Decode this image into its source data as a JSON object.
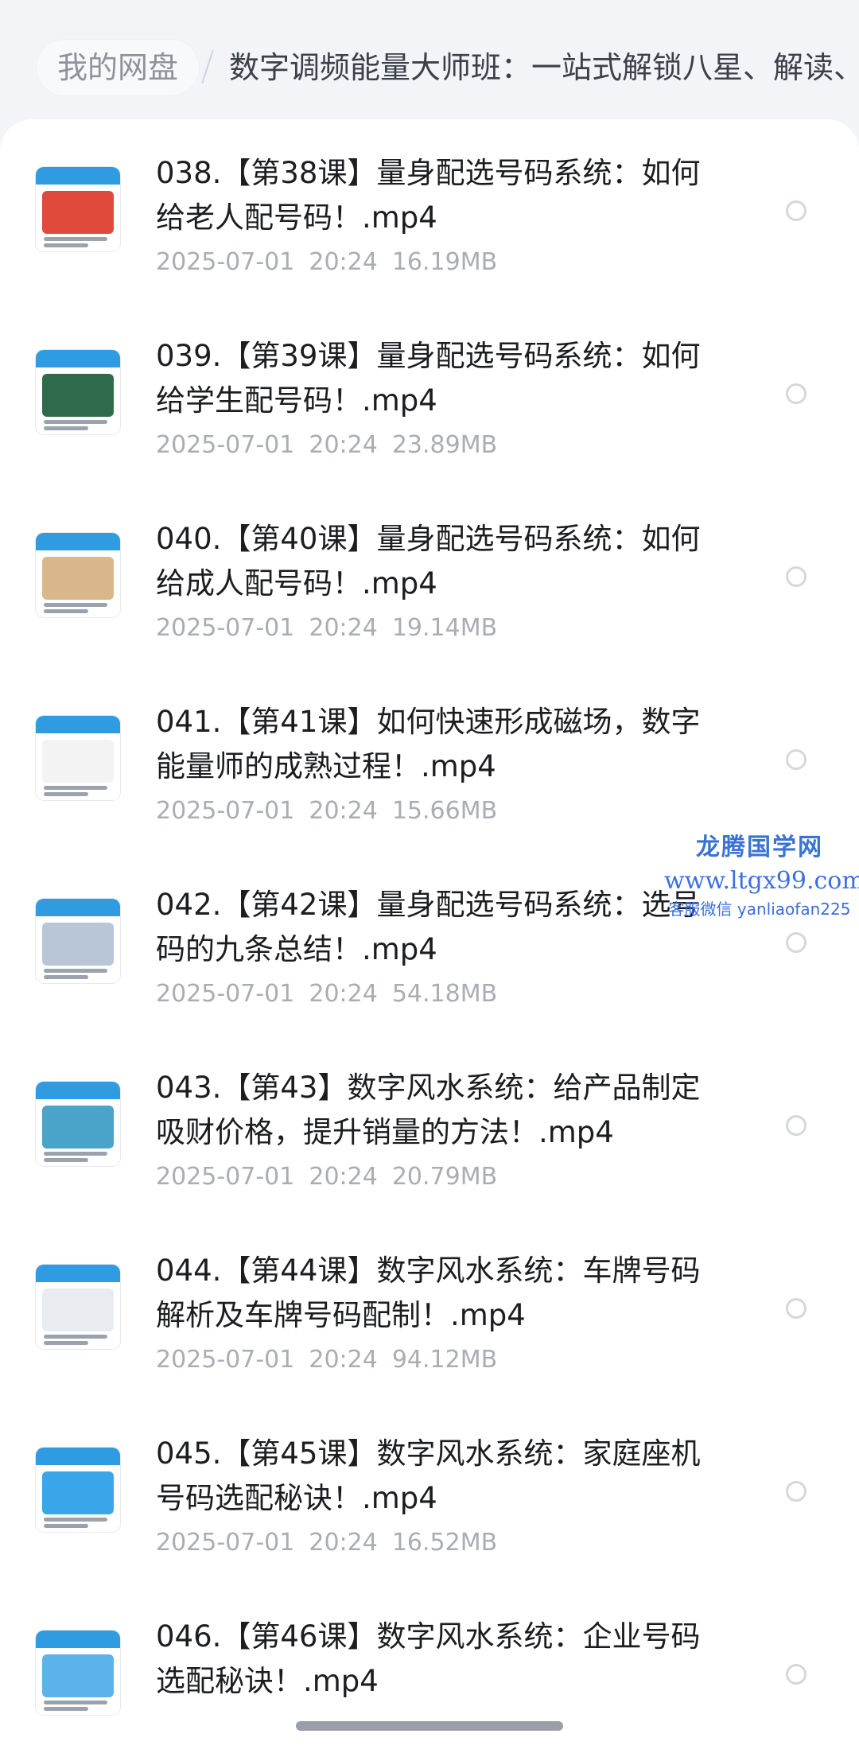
{
  "breadcrumb": {
    "root": "我的网盘",
    "current": "数字调频能量大师班：一站式解锁八星、解读、"
  },
  "files": [
    {
      "title": "038.【第38课】量身配选号码系统：如何给老人配号码！.mp4",
      "date": "2025-07-01",
      "time": "20:24",
      "size": "16.19MB",
      "thumb_color": "#e04a3a"
    },
    {
      "title": "039.【第39课】量身配选号码系统：如何给学生配号码！.mp4",
      "date": "2025-07-01",
      "time": "20:24",
      "size": "23.89MB",
      "thumb_color": "#2f6b4a"
    },
    {
      "title": "040.【第40课】量身配选号码系统：如何给成人配号码！.mp4",
      "date": "2025-07-01",
      "time": "20:24",
      "size": "19.14MB",
      "thumb_color": "#d9b78a"
    },
    {
      "title": "041.【第41课】如何快速形成磁场，数字能量师的成熟过程！.mp4",
      "date": "2025-07-01",
      "time": "20:24",
      "size": "15.66MB",
      "thumb_color": "#f3f3f3"
    },
    {
      "title": "042.【第42课】量身配选号码系统：选号码的九条总结！.mp4",
      "date": "2025-07-01",
      "time": "20:24",
      "size": "54.18MB",
      "thumb_color": "#b8c6d8"
    },
    {
      "title": "043.【第43】数字风水系统：给产品制定吸财价格，提升销量的方法！.mp4",
      "date": "2025-07-01",
      "time": "20:24",
      "size": "20.79MB",
      "thumb_color": "#4aa3c9"
    },
    {
      "title": "044.【第44课】数字风水系统：车牌号码解析及车牌号码配制！.mp4",
      "date": "2025-07-01",
      "time": "20:24",
      "size": "94.12MB",
      "thumb_color": "#e8ecf1"
    },
    {
      "title": "045.【第45课】数字风水系统：家庭座机号码选配秘诀！.mp4",
      "date": "2025-07-01",
      "time": "20:24",
      "size": "16.52MB",
      "thumb_color": "#3aa5e8"
    },
    {
      "title": "046.【第46课】数字风水系统：企业号码选配秘诀！.mp4",
      "date": "",
      "time": "",
      "size": "",
      "thumb_color": "#5bb3ea"
    }
  ],
  "watermark": {
    "title": "龙腾国学网",
    "url": "www.ltgx99.com",
    "contact": "客服微信 yanliaofan225"
  },
  "colors": {
    "background": "#f2f4f8",
    "panel": "#ffffff",
    "title_text": "#1b1d21",
    "meta_text": "#a9adb4",
    "watermark": "#3b6fe0"
  },
  "icons": {
    "select": "radio-circle-icon"
  }
}
